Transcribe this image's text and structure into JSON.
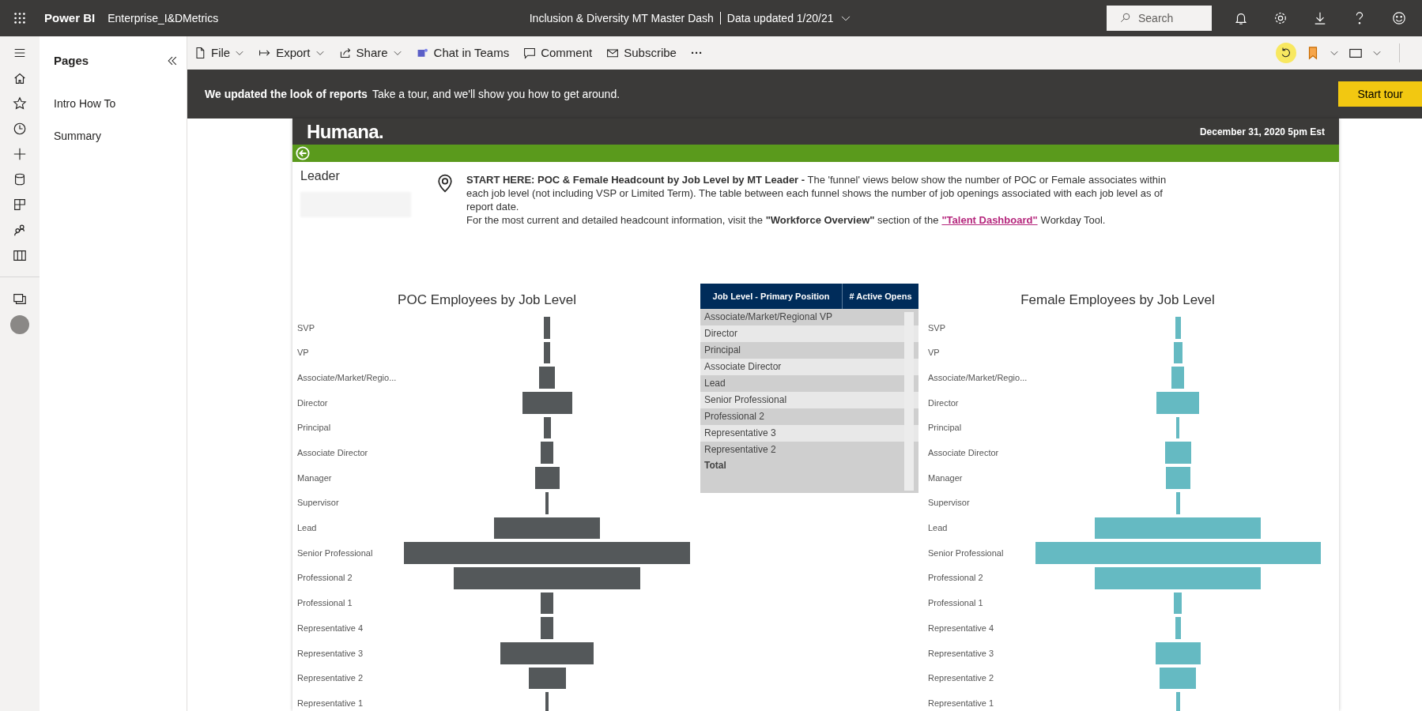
{
  "topbar": {
    "app": "Power BI",
    "workspace": "Enterprise_I&DMetrics",
    "report_title": "Inclusion & Diversity MT Master Dash",
    "updated": "Data updated 1/20/21",
    "search": {
      "placeholder": "Search"
    }
  },
  "pages_pane": {
    "title": "Pages",
    "pages": [
      {
        "label": "Intro How To",
        "selected": false
      },
      {
        "label": "Summary",
        "selected": false
      }
    ]
  },
  "toolbar": {
    "actions": [
      {
        "kind": "file",
        "label": "File",
        "dropdown": true
      },
      {
        "kind": "export",
        "label": "Export",
        "dropdown": true
      },
      {
        "kind": "share",
        "label": "Share",
        "dropdown": true
      },
      {
        "kind": "teams",
        "label": "Chat in Teams",
        "dropdown": false
      },
      {
        "kind": "comment",
        "label": "Comment",
        "dropdown": false
      },
      {
        "kind": "subscribe",
        "label": "Subscribe",
        "dropdown": false
      }
    ],
    "more": "···"
  },
  "banner": {
    "heading": "We updated the look of reports",
    "text": "Take a tour, and we'll show you how to get around.",
    "button": "Start tour"
  },
  "report": {
    "brand": "Humana.",
    "date": "December 31, 2020 5pm Est",
    "slicer_label": "Leader",
    "intro": [
      "**START HERE: POC & Female Headcount by Job Level by MT Leader -** The 'funnel' views below show the number of POC or Female associates within each job level (not including VSP or Limited Term). The table between each funnel shows the number of job openings associated with each job level as of report date."
    ],
    "intro_link_line": {
      "before": "For the most current and detailed headcount information, visit the **\"Workforce Overview\"** section of the",
      "link": "\"Talent Dashboard\"",
      "after": "Workday Tool."
    },
    "funnels": [
      {
        "title": "POC Employees by Job Level",
        "color": "#54585a",
        "labels": [
          "SVP",
          "VP",
          "Associate/Market/Regio...",
          "Director",
          "Principal",
          "Associate Director",
          "Manager",
          "Supervisor",
          "Lead",
          "Senior Professional",
          "Professional 2",
          "Professional 1",
          "Representative 4",
          "Representative 3",
          "Representative 2",
          "Representative 1"
        ]
      },
      {
        "title": "Female Employees by Job Level",
        "color": "#65bac2",
        "labels": [
          "SVP",
          "VP",
          "Associate/Market/Regio...",
          "Director",
          "Principal",
          "Associate Director",
          "Manager",
          "Supervisor",
          "Lead",
          "Senior Professional",
          "Professional 2",
          "Professional 1",
          "Representative 4",
          "Representative 3",
          "Representative 2",
          "Representative 1"
        ]
      }
    ],
    "table": {
      "columns": [
        "Job Level - Primary Position",
        "# Active Opens"
      ],
      "rows": [
        "Associate/Market/Regional VP",
        "Director",
        "Principal",
        "Associate Director",
        "Lead",
        "Senior Professional",
        "Professional 2",
        "Representative 3",
        "Representative 2"
      ],
      "total": "Total"
    }
  }
}
